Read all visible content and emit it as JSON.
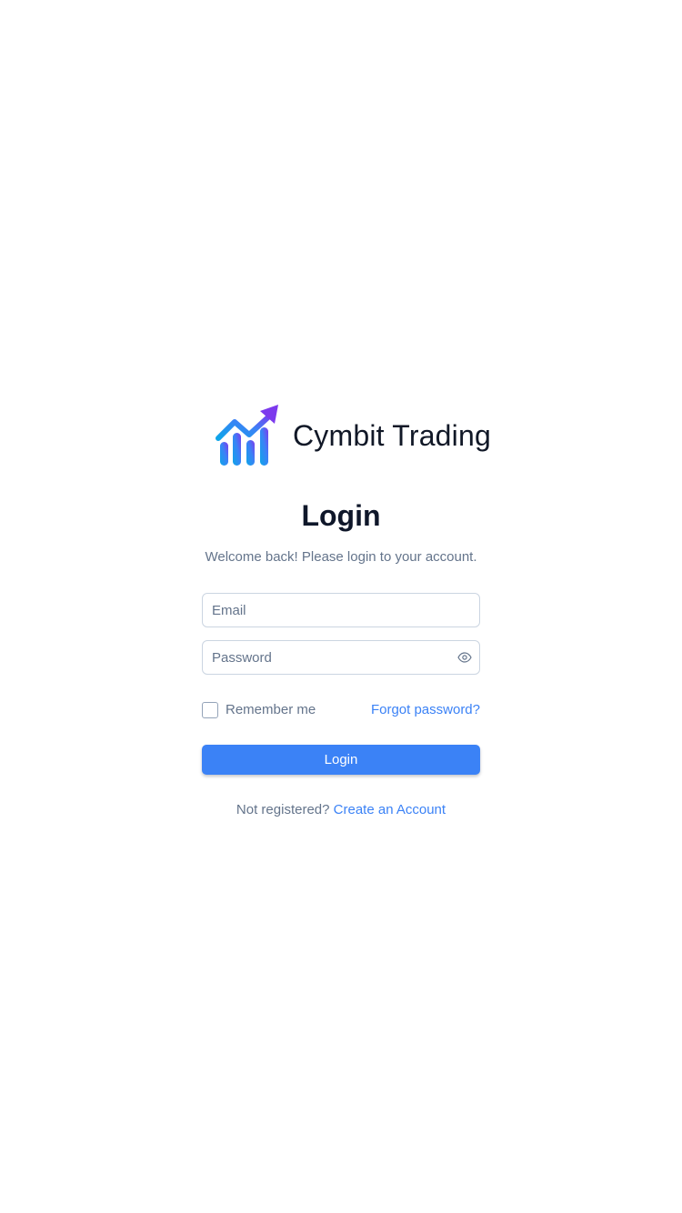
{
  "brand": {
    "name": "Cymbit Trading",
    "logo_icon": "trending-chart-logo-icon"
  },
  "login": {
    "title": "Login",
    "subtitle": "Welcome back! Please login to your account.",
    "email": {
      "placeholder": "Email",
      "value": ""
    },
    "password": {
      "placeholder": "Password",
      "value": "",
      "toggle_icon": "eye-icon"
    },
    "remember_label": "Remember me",
    "remember_checked": false,
    "forgot_label": "Forgot password?",
    "submit_label": "Login",
    "register_prompt": "Not registered?",
    "register_link": "Create an Account"
  },
  "colors": {
    "accent": "#3b82f6",
    "muted_text": "#64748b",
    "border": "#cbd5e1",
    "logo_gradient_start": "#0ea5e9",
    "logo_gradient_end": "#7c3aed"
  }
}
